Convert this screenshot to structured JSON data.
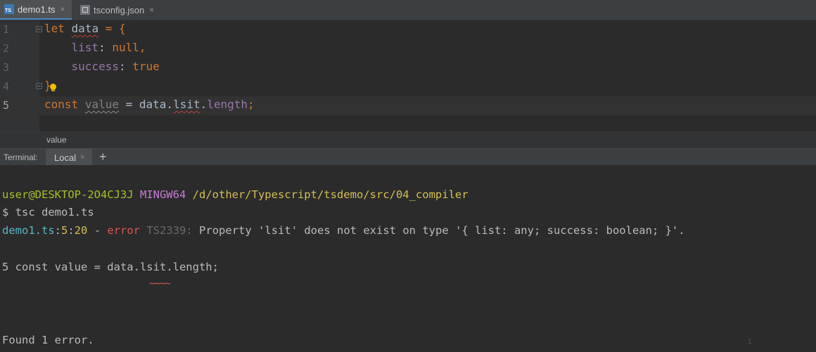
{
  "tabs": [
    {
      "label": "demo1.ts",
      "icon": "ts-file-icon",
      "active": true
    },
    {
      "label": "tsconfig.json",
      "icon": "json-file-icon",
      "active": false
    }
  ],
  "tab_close": "×",
  "ts_icon_text": "TS",
  "editor": {
    "line_numbers": [
      "1",
      "2",
      "3",
      "4",
      "5"
    ],
    "tokens": {
      "let": "let",
      "data": "data",
      "eq_brace": " = {",
      "indent": "    ",
      "list": "list",
      "colon": ": ",
      "null": "null",
      "comma": ",",
      "success": "success",
      "true": "true",
      "close_brace": "}",
      "const": "const",
      "sp": " ",
      "value": "value",
      "eq": " = ",
      "data2": "data",
      "dot": ".",
      "lsit": "lsit",
      "length": "length",
      "semi": ";"
    }
  },
  "breadcrumb": "value",
  "terminal": {
    "label": "Terminal:",
    "tab": "Local",
    "add": "+",
    "prompt_user": "user@DESKTOP-2O4CJ3J",
    "prompt_env": "MINGW64",
    "prompt_path": "/d/other/Typescript/tsdemo/src/04_compiler",
    "command": "$ tsc demo1.ts",
    "err_file": "demo1.ts",
    "err_colon": ":",
    "err_line": "5",
    "err_col": "20",
    "err_dash": " - ",
    "err_word": "error",
    "err_code": "TS2339:",
    "err_msg": "Property 'lsit' does not exist on type '{ list: any; success: boolean; }'.",
    "src_line": "5 const value = data.lsit.length;",
    "tildes": "~~~~",
    "summary": "Found 1 error.",
    "mark": "1"
  },
  "colors": {
    "keyword": "#cc7832",
    "property": "#9876aa",
    "text": "#a9b7c6",
    "background": "#2b2b2b",
    "error": "#e05555"
  }
}
